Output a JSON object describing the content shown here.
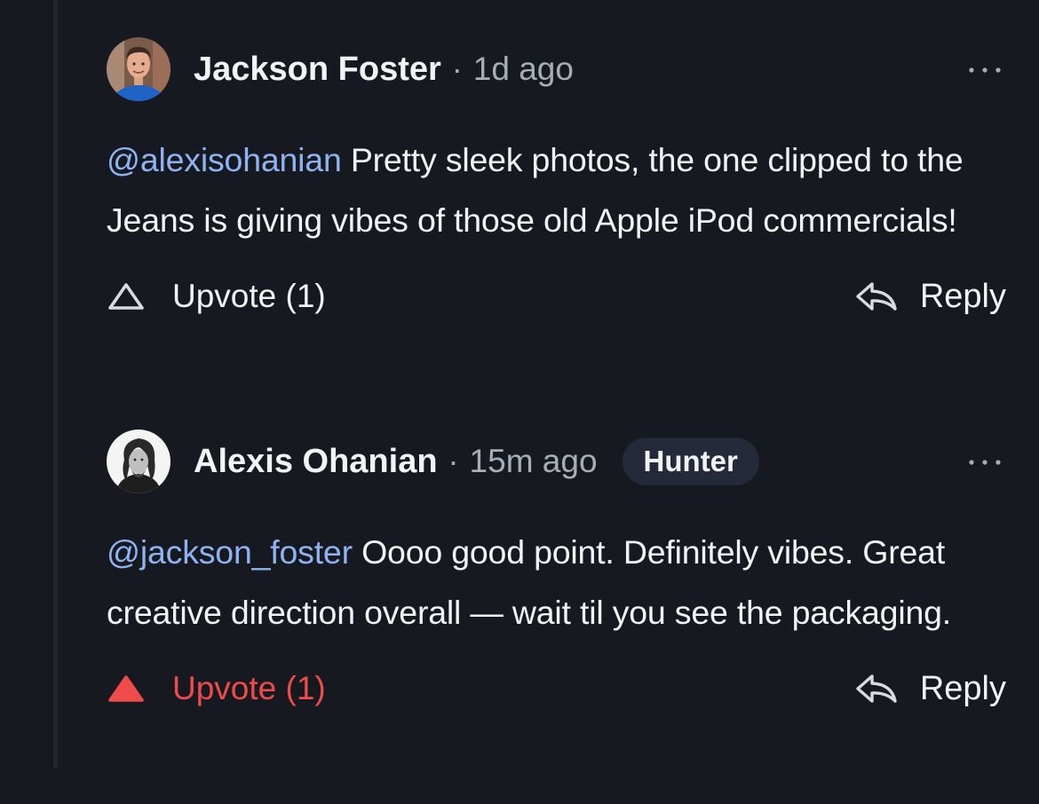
{
  "colors": {
    "background": "#171921",
    "thread_line": "#23262f",
    "text": "#f2f3f5",
    "muted": "#a9adb8",
    "mention": "#8fb2f0",
    "upvoted": "#ef4b4b",
    "badge_bg": "#242a3a"
  },
  "comments": [
    {
      "author": "Jackson Foster",
      "separator": "·",
      "time": "1d ago",
      "badge": "",
      "avatar_icon": "avatar-photo",
      "more_icon": "more-horizontal-icon",
      "mention": "@alexisohanian",
      "text": " Pretty sleek photos, the one clipped to the Jeans is giving vibes of those old Apple iPod commercials!",
      "upvote_label": "Upvote (1)",
      "upvoted": false,
      "upvote_icon": "triangle-up-outline-icon",
      "reply_label": "Reply",
      "reply_icon": "reply-arrow-icon"
    },
    {
      "author": "Alexis Ohanian",
      "separator": "·",
      "time": "15m ago",
      "badge": "Hunter",
      "avatar_icon": "avatar-photo",
      "more_icon": "more-horizontal-icon",
      "mention": "@jackson_foster",
      "text": " Oooo good point. Definitely vibes. Great creative direction overall — wait til you see the packaging.",
      "upvote_label": "Upvote (1)",
      "upvoted": true,
      "upvote_icon": "triangle-up-filled-icon",
      "reply_label": "Reply",
      "reply_icon": "reply-arrow-icon"
    }
  ]
}
